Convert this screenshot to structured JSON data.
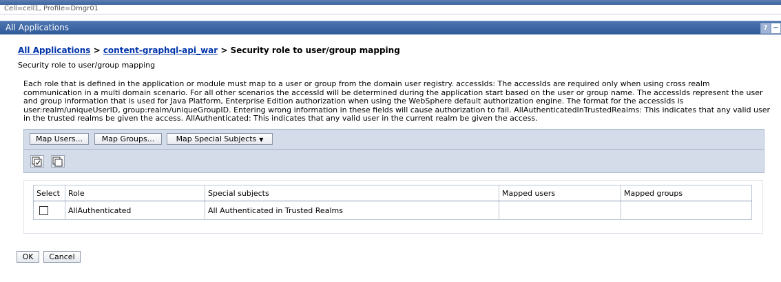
{
  "context": "Cell=cell1, Profile=Dmgr01",
  "window": {
    "title": "All Applications",
    "help_icon": "question-mark-icon",
    "minimize_icon": "minimize-icon"
  },
  "breadcrumb": {
    "item1": "All Applications",
    "sep": ">",
    "item2": "content-graphql-api_war",
    "current": "Security role to user/group mapping"
  },
  "page": {
    "subtitle": "Security role to user/group mapping",
    "description": "Each role that is defined in the application or module must map to a user or group from the domain user registry. accessIds: The accessIds are required only when using cross realm communication in a multi domain scenario. For all other scenarios the accessId will be determined during the application start based on the user or group name. The accessIds represent the user and group information that is used for Java Platform, Enterprise Edition authorization when using the WebSphere default authorization engine. The format for the accessIds is user:realm/uniqueUserID, group:realm/uniqueGroupID. Entering wrong information in these fields will cause authorization to fail. AllAuthenticatedInTrustedRealms: This indicates that any valid user in the trusted realms be given the access. AllAuthenticated: This indicates that any valid user in the current realm be given the access."
  },
  "toolbar": {
    "map_users": "Map Users...",
    "map_groups": "Map Groups...",
    "map_special": "Map Special Subjects",
    "select_all_icon": "select-all-icon",
    "deselect_all_icon": "deselect-all-icon"
  },
  "table": {
    "headers": {
      "select": "Select",
      "role": "Role",
      "special": "Special subjects",
      "users": "Mapped users",
      "groups": "Mapped groups"
    },
    "rows": [
      {
        "selected": false,
        "role": "AllAuthenticated",
        "special": "All Authenticated in Trusted Realms",
        "users": "",
        "groups": ""
      }
    ]
  },
  "actions": {
    "ok": "OK",
    "cancel": "Cancel"
  }
}
